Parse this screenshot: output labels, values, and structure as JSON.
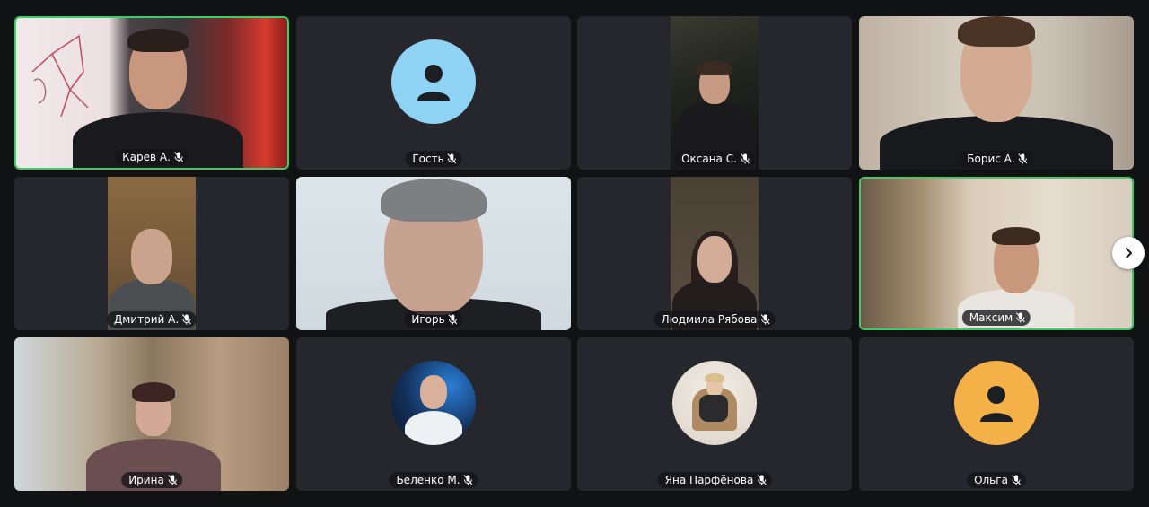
{
  "participants": [
    {
      "name": "Карев А.",
      "mic_icon": "mic-muted-icon",
      "active": true
    },
    {
      "name": "Гость",
      "mic_icon": "mic-muted-icon",
      "avatar_color": "#8fd3f4"
    },
    {
      "name": "Оксана С.",
      "mic_icon": "mic-muted-icon"
    },
    {
      "name": "Борис А.",
      "mic_icon": "mic-muted-icon"
    },
    {
      "name": "Дмитрий А.",
      "mic_icon": "mic-muted-icon"
    },
    {
      "name": "Игорь",
      "mic_icon": "mic-muted-icon"
    },
    {
      "name": "Людмила Рябова",
      "mic_icon": "mic-muted-icon"
    },
    {
      "name": "Максим",
      "mic_icon": "mic-muted-icon",
      "active": true
    },
    {
      "name": "Ирина",
      "mic_icon": "mic-muted-icon"
    },
    {
      "name": "Беленко М.",
      "mic_icon": "mic-muted-icon"
    },
    {
      "name": "Яна Парфёнова",
      "mic_icon": "mic-muted-icon"
    },
    {
      "name": "Ольга",
      "mic_icon": "mic-muted-icon",
      "avatar_color": "#f3b148"
    }
  ],
  "controls": {
    "next_page_icon": "chevron-right-icon"
  },
  "colors": {
    "background": "#111214",
    "tile": "#25272c",
    "active_border": "#3ecb6a"
  }
}
